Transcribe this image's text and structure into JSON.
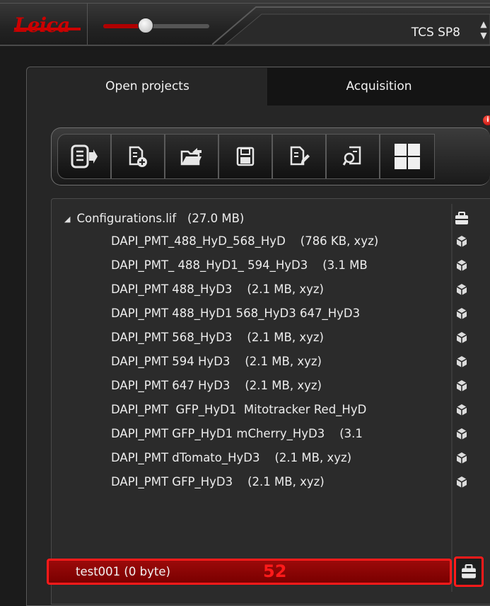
{
  "app": {
    "device_name": "TCS SP8",
    "brand_logo_text": "Leica",
    "zoom_slider_level": 0.4
  },
  "tabs": [
    {
      "label": "Open projects",
      "selected": true
    },
    {
      "label": "Acquisition",
      "selected": false
    }
  ],
  "info_badge": "i",
  "toolbar": {
    "buttons": [
      {
        "icon": "close-project-icon"
      },
      {
        "icon": "new-project-icon"
      },
      {
        "icon": "open-project-icon"
      },
      {
        "icon": "save-icon"
      },
      {
        "icon": "save-as-icon"
      },
      {
        "icon": "find-icon"
      },
      {
        "icon": "thumbnail-view-icon"
      }
    ]
  },
  "project_tree": {
    "root": {
      "name": "Configurations.lif",
      "size": "(27.0 MB)",
      "icon": "project-case-icon"
    },
    "items": [
      {
        "label": "DAPI_PMT_488_HyD_568_HyD    (786 KB, xyz)",
        "icon": "3d-stack-icon"
      },
      {
        "label": "DAPI_PMT_ 488_HyD1_ 594_HyD3    (3.1 MB",
        "icon": "3d-stack-icon"
      },
      {
        "label": "DAPI_PMT 488_HyD3    (2.1 MB, xyz)",
        "icon": "3d-stack-icon"
      },
      {
        "label": "DAPI_PMT 488_HyD1 568_HyD3 647_HyD3",
        "icon": "3d-stack-icon"
      },
      {
        "label": "DAPI_PMT 568_HyD3    (2.1 MB, xyz)",
        "icon": "3d-stack-icon"
      },
      {
        "label": "DAPI_PMT 594 HyD3    (2.1 MB, xyz)",
        "icon": "3d-stack-icon"
      },
      {
        "label": "DAPI_PMT 647 HyD3    (2.1 MB, xyz)",
        "icon": "3d-stack-icon"
      },
      {
        "label": "DAPI_PMT  GFP_HyD1  Mitotracker Red_HyD",
        "icon": "3d-stack-icon"
      },
      {
        "label": "DAPI_PMT GFP_HyD1 mCherry_HyD3    (3.1",
        "icon": "3d-stack-icon"
      },
      {
        "label": "DAPI_PMT dTomato_HyD3    (2.1 MB, xyz)",
        "icon": "3d-stack-icon"
      },
      {
        "label": "DAPI_PMT GFP_HyD3    (2.1 MB, xyz)",
        "icon": "3d-stack-icon"
      }
    ],
    "selected_project": {
      "label": "test001    (0 byte)",
      "badge": "52",
      "icon": "project-case-icon"
    }
  },
  "colors": {
    "accent_red": "#ff1a1a",
    "selected_row": "#8a0505",
    "background": "#262626"
  }
}
